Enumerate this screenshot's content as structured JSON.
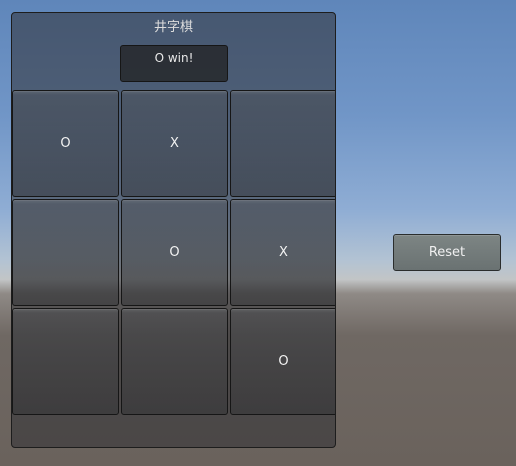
{
  "window": {
    "title": "井字棋"
  },
  "status": {
    "text": "O win!"
  },
  "board": {
    "cells": [
      [
        "O",
        "X",
        ""
      ],
      [
        "",
        "O",
        "X"
      ],
      [
        "",
        "",
        "O"
      ]
    ]
  },
  "controls": {
    "reset_label": "Reset"
  }
}
